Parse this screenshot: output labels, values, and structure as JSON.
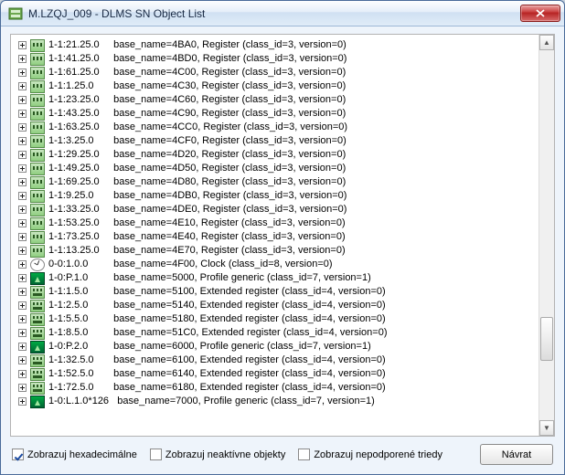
{
  "window": {
    "title": "M.LZQJ_009 - DLMS SN Object List"
  },
  "scrollbar": {
    "thumb_top_pct": 72,
    "thumb_height_pct": 12
  },
  "rows": [
    {
      "icon": "register",
      "obis": "1-1:21.25.0",
      "desc": "base_name=4BA0, Register (class_id=3, version=0)"
    },
    {
      "icon": "register",
      "obis": "1-1:41.25.0",
      "desc": "base_name=4BD0, Register (class_id=3, version=0)"
    },
    {
      "icon": "register",
      "obis": "1-1:61.25.0",
      "desc": "base_name=4C00, Register (class_id=3, version=0)"
    },
    {
      "icon": "register",
      "obis": "1-1:1.25.0",
      "desc": "base_name=4C30, Register (class_id=3, version=0)"
    },
    {
      "icon": "register",
      "obis": "1-1:23.25.0",
      "desc": "base_name=4C60, Register (class_id=3, version=0)"
    },
    {
      "icon": "register",
      "obis": "1-1:43.25.0",
      "desc": "base_name=4C90, Register (class_id=3, version=0)"
    },
    {
      "icon": "register",
      "obis": "1-1:63.25.0",
      "desc": "base_name=4CC0, Register (class_id=3, version=0)"
    },
    {
      "icon": "register",
      "obis": "1-1:3.25.0",
      "desc": "base_name=4CF0, Register (class_id=3, version=0)"
    },
    {
      "icon": "register",
      "obis": "1-1:29.25.0",
      "desc": "base_name=4D20, Register (class_id=3, version=0)"
    },
    {
      "icon": "register",
      "obis": "1-1:49.25.0",
      "desc": "base_name=4D50, Register (class_id=3, version=0)"
    },
    {
      "icon": "register",
      "obis": "1-1:69.25.0",
      "desc": "base_name=4D80, Register (class_id=3, version=0)"
    },
    {
      "icon": "register",
      "obis": "1-1:9.25.0",
      "desc": "base_name=4DB0, Register (class_id=3, version=0)"
    },
    {
      "icon": "register",
      "obis": "1-1:33.25.0",
      "desc": "base_name=4DE0, Register (class_id=3, version=0)"
    },
    {
      "icon": "register",
      "obis": "1-1:53.25.0",
      "desc": "base_name=4E10, Register (class_id=3, version=0)"
    },
    {
      "icon": "register",
      "obis": "1-1:73.25.0",
      "desc": "base_name=4E40, Register (class_id=3, version=0)"
    },
    {
      "icon": "register",
      "obis": "1-1:13.25.0",
      "desc": "base_name=4E70, Register (class_id=3, version=0)"
    },
    {
      "icon": "clock",
      "obis": "0-0:1.0.0",
      "desc": "base_name=4F00, Clock (class_id=8, version=0)"
    },
    {
      "icon": "profile",
      "obis": "1-0:P.1.0",
      "desc": "base_name=5000, Profile generic (class_id=7, version=1)"
    },
    {
      "icon": "ext",
      "obis": "1-1:1.5.0",
      "desc": "base_name=5100, Extended register (class_id=4, version=0)"
    },
    {
      "icon": "ext",
      "obis": "1-1:2.5.0",
      "desc": "base_name=5140, Extended register (class_id=4, version=0)"
    },
    {
      "icon": "ext",
      "obis": "1-1:5.5.0",
      "desc": "base_name=5180, Extended register (class_id=4, version=0)"
    },
    {
      "icon": "ext",
      "obis": "1-1:8.5.0",
      "desc": "base_name=51C0, Extended register (class_id=4, version=0)"
    },
    {
      "icon": "profile",
      "obis": "1-0:P.2.0",
      "desc": "base_name=6000, Profile generic (class_id=7, version=1)"
    },
    {
      "icon": "ext",
      "obis": "1-1:32.5.0",
      "desc": "base_name=6100, Extended register (class_id=4, version=0)"
    },
    {
      "icon": "ext",
      "obis": "1-1:52.5.0",
      "desc": "base_name=6140, Extended register (class_id=4, version=0)"
    },
    {
      "icon": "ext",
      "obis": "1-1:72.5.0",
      "desc": "base_name=6180, Extended register (class_id=4, version=0)"
    },
    {
      "icon": "profile",
      "obis": "1-0:L.1.0*126",
      "desc": "base_name=7000, Profile generic (class_id=7, version=1)"
    }
  ],
  "footer": {
    "checkboxes": [
      {
        "label": "Zobrazuj hexadecimálne",
        "checked": true
      },
      {
        "label": "Zobrazuj neaktívne objekty",
        "checked": false
      },
      {
        "label": "Zobrazuj nepodporené triedy",
        "checked": false
      }
    ],
    "return_button": "Návrat"
  }
}
